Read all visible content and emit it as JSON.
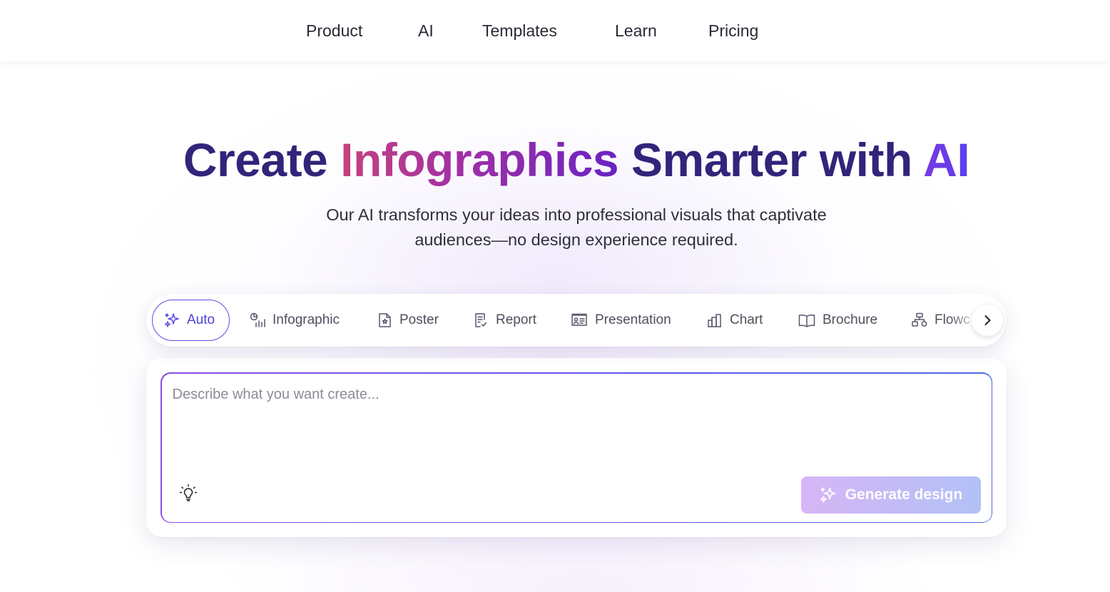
{
  "nav": {
    "items": [
      {
        "label": "Product"
      },
      {
        "label": "AI"
      },
      {
        "label": "Templates"
      },
      {
        "label": "Learn"
      },
      {
        "label": "Pricing"
      }
    ]
  },
  "hero": {
    "title_part1": "Create",
    "title_highlight": "Infographics",
    "title_part2": "Smarter with",
    "title_ai": "AI",
    "subtitle_line1": "Our AI transforms your ideas into professional visuals that captivate",
    "subtitle_line2": "audiences—no design experience required."
  },
  "tabs": {
    "active": "Auto",
    "items": [
      {
        "label": "Auto",
        "icon": "sparkle-icon"
      },
      {
        "label": "Infographic",
        "icon": "infographic-icon"
      },
      {
        "label": "Poster",
        "icon": "poster-icon"
      },
      {
        "label": "Report",
        "icon": "report-icon"
      },
      {
        "label": "Presentation",
        "icon": "presentation-icon"
      },
      {
        "label": "Chart",
        "icon": "bar-chart-icon"
      },
      {
        "label": "Brochure",
        "icon": "book-open-icon"
      },
      {
        "label": "Flowchart",
        "visible_label": "Flowc",
        "icon": "flowchart-icon"
      }
    ],
    "next_icon": "chevron-right-icon"
  },
  "prompt": {
    "placeholder": "Describe what you want create...",
    "value": "",
    "idea_icon": "lightbulb-icon",
    "generate_label": "Generate design",
    "generate_icon": "sparkle-icon"
  },
  "colors": {
    "title_dark": "#33237a",
    "accent": "#5b4ce0",
    "generate_gradient_start": "#d7b5f6",
    "generate_gradient_end": "#b1c1f6"
  }
}
